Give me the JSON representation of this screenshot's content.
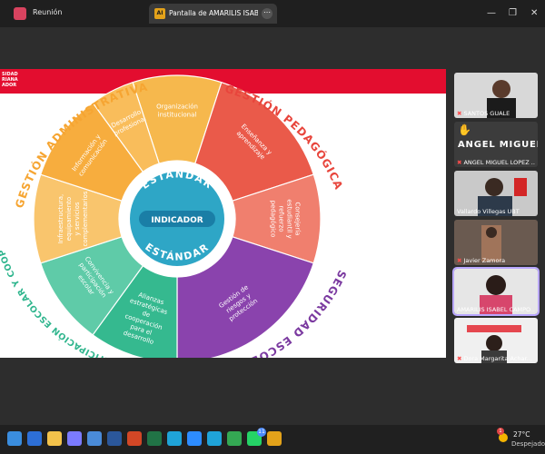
{
  "app": {
    "title": "Reunión"
  },
  "share": {
    "badge": "AI",
    "tab_text": "Pantalla de AMARILIS ISABEL CAM",
    "menu_icon": "more-icon"
  },
  "window": {
    "controls": [
      "—",
      "❐",
      "✕"
    ]
  },
  "slide": {
    "brand_lines": [
      "SIDAD",
      "RIANA",
      "ADOR"
    ],
    "center_title_top": "ESTÁNDAR",
    "center_title_bottom": "ESTÁNDAR",
    "center_label": "INDICADOR",
    "sections": [
      {
        "name": "GESTIÓN ADMINISTRATIVA",
        "color": "#f6a532"
      },
      {
        "name": "GESTIÓN PEDAGÓGICA",
        "color": "#e8453c"
      },
      {
        "name": "SEGURIDAD ESCOLAR",
        "color": "#7b3aa0"
      },
      {
        "name": "CONVIVENCIA, PARTICIPACIÓN ESCOLAR Y COOPERACIÓN",
        "color": "#2fb58d"
      }
    ],
    "segments": [
      {
        "label": "Organización institucional",
        "color": "#f6b84d"
      },
      {
        "label": "Enseñanza y aprendizaje",
        "color": "#ea5a4a"
      },
      {
        "label": "Consejería estudiantil y refuerzo pedagógico",
        "color": "#f07f6e"
      },
      {
        "label": "Gestión de riesgos y protección",
        "color": "#8a43ad"
      },
      {
        "label": "Alianzas estratégicas de cooperación para el desarrollo",
        "color": "#35b98f"
      },
      {
        "label": "Convivencia y participación escolar",
        "color": "#5fcba8"
      },
      {
        "label": "Infraestructura, equipamiento y servicios complementarios",
        "color": "#f9c56d"
      },
      {
        "label": "Información y comunicación",
        "color": "#f7ad3e"
      },
      {
        "label": "Desarrollo profesional",
        "color": "#f9bd5b"
      }
    ]
  },
  "participants": [
    {
      "name": "SANTOS GUALE",
      "muted": true
    },
    {
      "name": "ANGEL MIGUEL LOPEZ ...",
      "big_name": "ANGEL MIGUEL...",
      "muted": true,
      "hand_raised": true
    },
    {
      "name": "Vallardo Villegas UBT",
      "muted": false
    },
    {
      "name": "Javier Zamora",
      "muted": true
    },
    {
      "name": "AMARILIS ISABEL CAMPO...",
      "muted": false,
      "active": true
    },
    {
      "name": "Dora Margarita Achar...",
      "muted": true
    }
  ],
  "taskbar": {
    "icons": [
      "windows-start-icon",
      "search-icon",
      "file-explorer-icon",
      "copilot-icon",
      "store-icon",
      "word-icon",
      "powerpoint-icon",
      "excel-icon",
      "edge-icon",
      "zoom-icon",
      "edge-icon",
      "chrome-icon",
      "whatsapp-icon",
      "folder-icon"
    ],
    "whatsapp_badge": "11",
    "weather_temp": "27°C",
    "weather_cond": "Despejado",
    "weather_badge": "1"
  }
}
